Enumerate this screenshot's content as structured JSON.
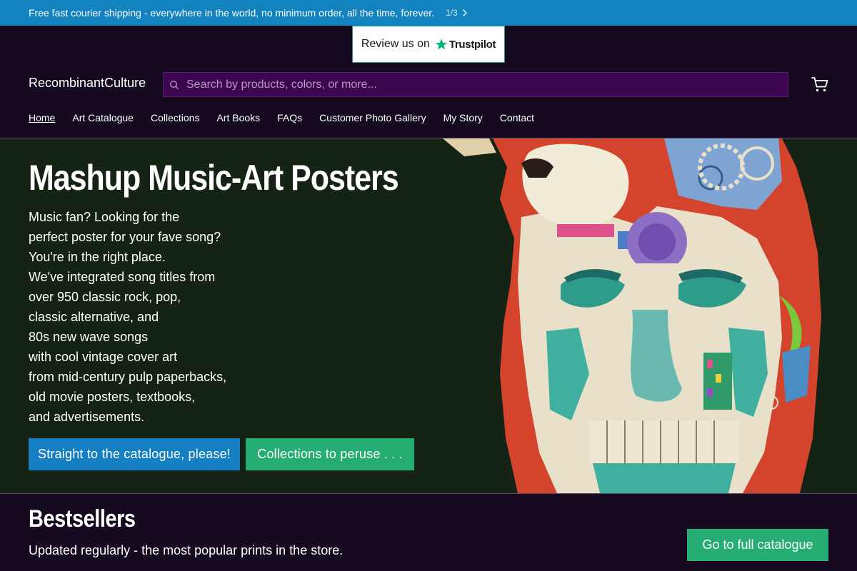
{
  "announcement": {
    "text": "Free fast courier shipping - everywhere in the world, no minimum order, all the time, forever.",
    "pager": "1/3"
  },
  "trustpilot": {
    "prefix": "Review us on",
    "logo_text": "Trustpilot"
  },
  "header": {
    "brand": "RecombinantCulture",
    "search_placeholder": "Search by products, colors, or more..."
  },
  "nav": {
    "items": [
      {
        "label": "Home"
      },
      {
        "label": "Art Catalogue"
      },
      {
        "label": "Collections"
      },
      {
        "label": "Art Books"
      },
      {
        "label": "FAQs"
      },
      {
        "label": "Customer Photo Gallery"
      },
      {
        "label": "My Story"
      },
      {
        "label": "Contact"
      }
    ]
  },
  "hero": {
    "title": "Mashup Music-Art Posters",
    "lines": [
      "Music fan? Looking for the",
      "perfect poster for your fave song?",
      "You're in the right place.",
      "We've integrated song titles from",
      "over 950 classic rock, pop,",
      "classic alternative, and",
      "80s new wave songs",
      "with cool vintage cover art",
      "from mid-century pulp paperbacks,",
      "old movie posters, textbooks,",
      "and advertisements."
    ],
    "primary_button": "Straight to the catalogue, please!",
    "secondary_button": "Collections to peruse . . ."
  },
  "bestsellers": {
    "title": "Bestsellers",
    "subtitle": "Updated regularly - the most popular prints in the store.",
    "button": "Go to full catalogue"
  },
  "colors": {
    "announcement_bg": "#1383c0",
    "page_bg": "#150a1f",
    "hero_bg": "#142314",
    "search_bg": "#3c0650",
    "button_blue": "#1480c3",
    "button_green": "#26ad73",
    "trustpilot_star": "#00b67a"
  },
  "icons": {
    "announcement_next": "chevron-right-icon",
    "search": "search-icon",
    "cart": "cart-icon",
    "trustpilot": "star-icon"
  }
}
